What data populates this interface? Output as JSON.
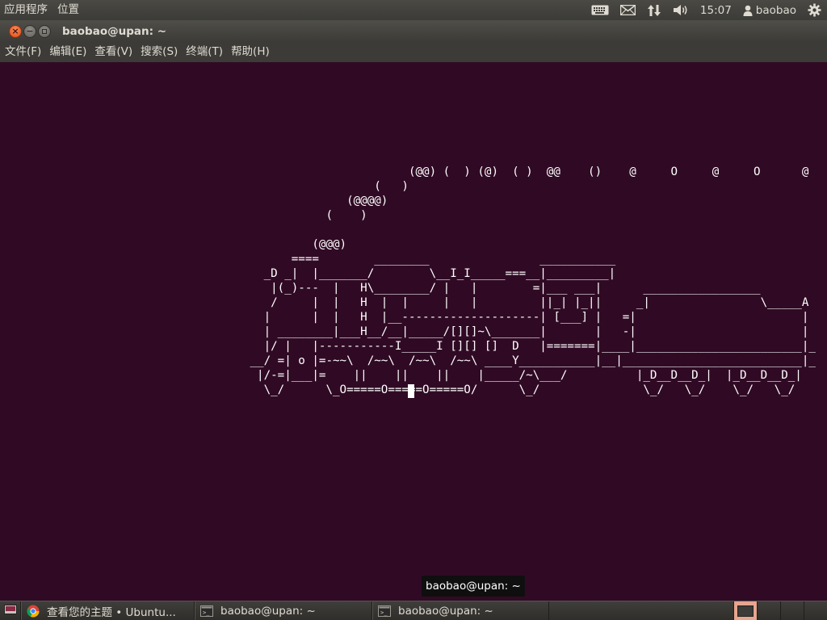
{
  "top_panel": {
    "menus": [
      "应用程序",
      "位置"
    ],
    "clock": "15:07",
    "user": "baobao",
    "indicators": [
      "keyboard-icon",
      "mail-icon",
      "network-icon",
      "volume-icon",
      "user-icon",
      "power-gear-icon"
    ]
  },
  "window": {
    "title": "baobao@upan: ~",
    "menu": [
      "文件(F)",
      "编辑(E)",
      "查看(V)",
      "搜索(S)",
      "终端(T)",
      "帮助(H)"
    ]
  },
  "terminal": {
    "background": "#300a24",
    "foreground": "#ffffff",
    "ascii_art": "                                                           (@@) (  ) (@)  ( )  @@    ()    @     O     @     O      @\n                                                      (   )\n                                                  (@@@@)\n                                               (    )\n\n                                             (@@@)\n                                          ====        ________                ___________\n                                      _D _|  |_______/        \\__I_I_____===__|_________|\n                                       |(_)---  |   H\\________/ |   |        =|___ ___|      _________________\n                                       /     |  |   H  |  |     |   |         ||_| |_||     _|                \\_____A\n                                      |      |  |   H  |__--------------------| [___] |   =|                        |\n                                      | ________|___H__/__|_____/[][]~\\_______|       |   -|                        |\n                                      |/ |   |-----------I_____I [][] []  D   |=======|____|________________________|_\n                                    __/ =| o |=-~~\\  /~~\\  /~~\\  /~~\\ ____Y___________|__|__________________________|_\n                                     |/-=|___|=    ||    ||    ||    |_____/~\\___/          |_D__D__D_|  |_D__D__D_|\n                                      \\_/      \\_O=====O=====O=====O/      \\_/               \\_/   \\_/    \\_/   \\_/"
  },
  "tooltip": "baobao@upan: ~",
  "taskbar": {
    "tasks": [
      {
        "icon": "chrome-icon",
        "label": "查看您的主题 • Ubuntu..."
      },
      {
        "icon": "terminal-icon",
        "label": "baobao@upan: ~"
      },
      {
        "icon": "terminal-icon",
        "label": "baobao@upan: ~"
      }
    ],
    "workspaces": 4
  }
}
